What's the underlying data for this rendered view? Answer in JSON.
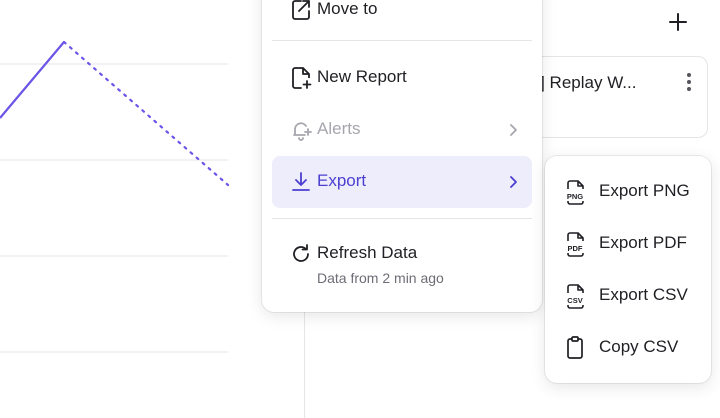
{
  "menu": {
    "move_to": "Move to",
    "new_report": "New Report",
    "alerts": "Alerts",
    "export": "Export",
    "refresh_data": "Refresh Data",
    "refresh_subtext": "Data from 2 min ago"
  },
  "submenu": {
    "export_png": "Export PNG",
    "export_pdf": "Export PDF",
    "export_csv": "Export CSV",
    "copy_csv": "Copy CSV"
  },
  "report_card": {
    "title_partial": "er] Replay W..."
  },
  "icons": {
    "move_to": "move-to-icon",
    "new_report": "new-report-icon",
    "alerts": "bell-plus-icon",
    "export": "download-icon",
    "refresh": "refresh-icon",
    "png": "png-file-icon",
    "pdf": "pdf-file-icon",
    "csv": "csv-file-icon",
    "copy": "clipboard-icon",
    "plus": "plus-icon",
    "kebab": "kebab-menu-icon"
  },
  "colors": {
    "accent": "#4b3fd1",
    "active_bg": "#eeedfb",
    "chart_line": "#6a55e8",
    "muted_text": "#6d6d76",
    "disabled_text": "#a6a6ae"
  }
}
